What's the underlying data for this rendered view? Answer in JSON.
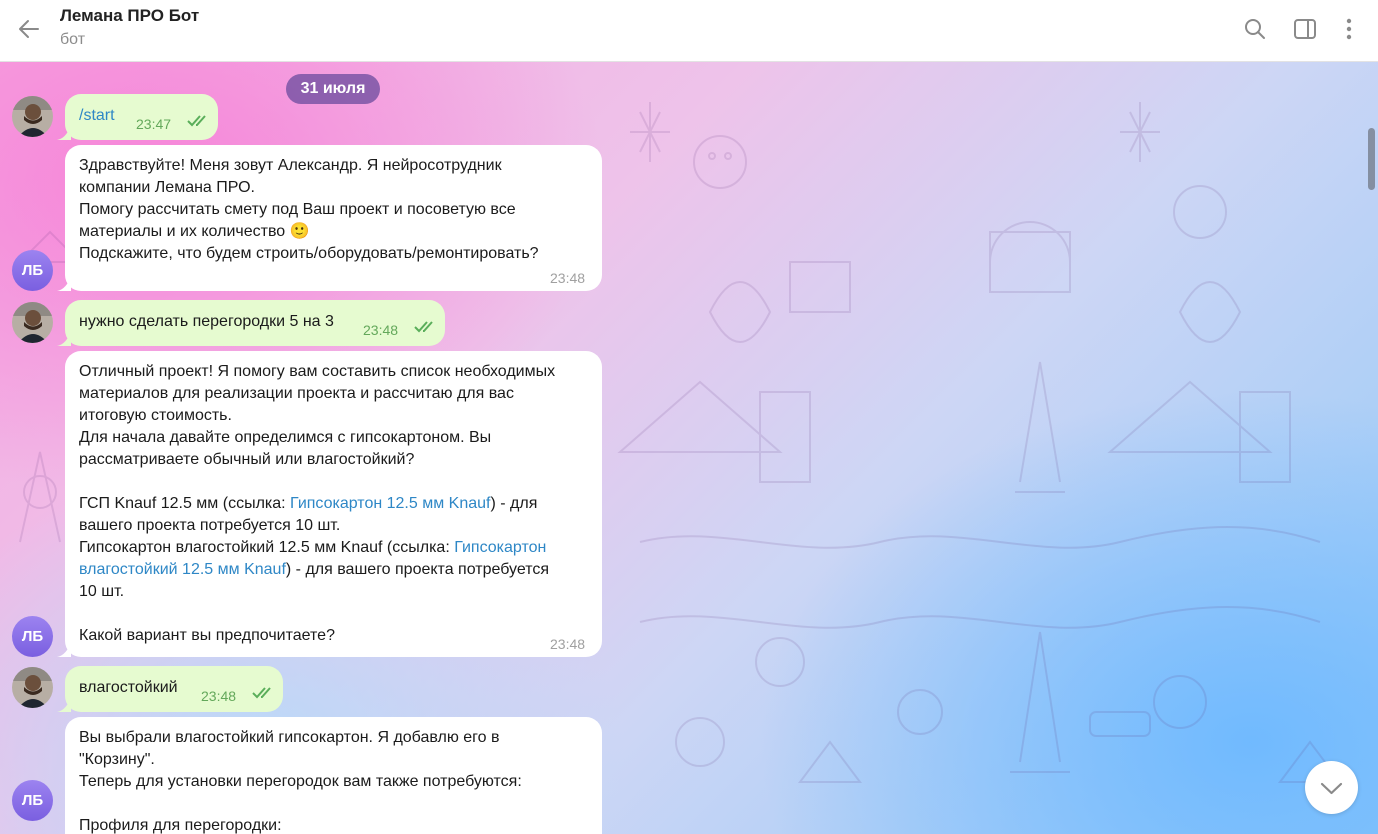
{
  "header": {
    "title": "Лемана ПРО Бот",
    "subtitle": "бот",
    "icons": [
      "back-arrow-icon",
      "search-icon",
      "sidebar-toggle-icon",
      "more-vertical-icon"
    ]
  },
  "chat": {
    "date": "31 июля",
    "bot_avatar_initials": "ЛБ",
    "messages": [
      {
        "from": "user",
        "text": "/start",
        "time": "23:47"
      },
      {
        "from": "bot",
        "lines": [
          "Здравствуйте! Меня зовут Александр. Я нейросотрудник",
          "компании Лемана ПРО.",
          "Помогу рассчитать смету под Ваш проект и посоветую все",
          "материалы и их количество",
          "Подскажите, что будем строить/оборудовать/ремонтировать?"
        ],
        "emoji": "🙂",
        "time": "23:48"
      },
      {
        "from": "user",
        "text": "нужно сделать перегородки 5 на 3",
        "time": "23:48"
      },
      {
        "from": "bot",
        "lines": [
          "Отличный проект! Я помогу вам составить список необходимых",
          "материалов для реализации проекта и рассчитаю для вас",
          "итоговую стоимость.",
          "Для начала давайте определимся с гипсокартоном. Вы",
          "рассматриваете обычный или влагостойкий?",
          "",
          "ГСП Knauf 12.5 мм (ссылка: ",
          "Гипсокартон 12.5 мм Knauf",
          ") - для",
          "вашего проекта потребуется 10 шт.",
          "Гипсокартон влагостойкий 12.5 мм Knauf (ссылка: ",
          "Гипсокартон",
          "влагостойкий 12.5 мм Knauf",
          ") - для вашего проекта потребуется",
          "10 шт.",
          "",
          "Какой вариант вы предпочитаете?"
        ],
        "time": "23:48"
      },
      {
        "from": "user",
        "text": "влагостойкий",
        "time": "23:48"
      },
      {
        "from": "bot",
        "lines": [
          "Вы выбрали влагостойкий гипсокартон. Я добавлю его в",
          "\"Корзину\".",
          "Теперь для установки перегородок вам также потребуются:",
          "",
          "Профиля для перегородки:"
        ]
      }
    ]
  },
  "colors": {
    "outgoing_bubble": "#e6fbd0",
    "incoming_bubble": "#ffffff",
    "link": "#2e87c6",
    "date_pill": "#704ea0",
    "bot_avatar": "#8a70ea"
  }
}
